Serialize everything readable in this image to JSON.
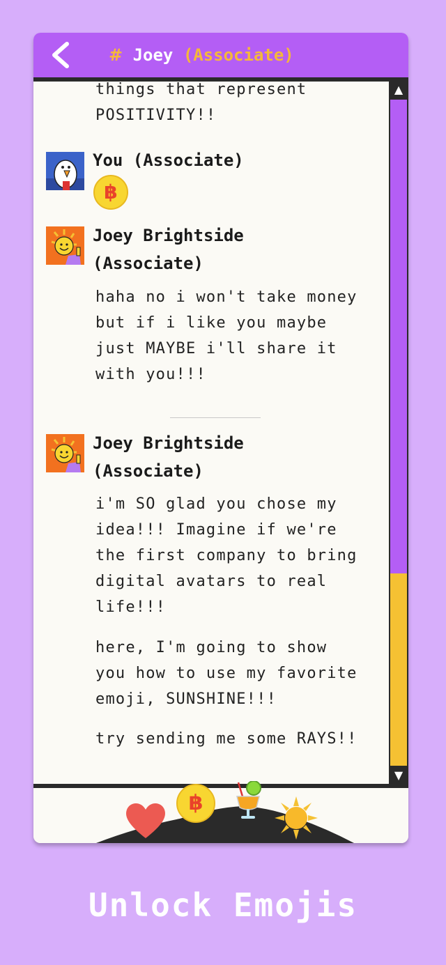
{
  "header": {
    "back_icon": "chevron-left-icon",
    "channel_hash": "#",
    "channel_name": "Joey",
    "channel_role": "(Associate)"
  },
  "messages": [
    {
      "lines": [
        "things that represent",
        "POSITIVITY!!"
      ]
    },
    {
      "author": "You (Associate)",
      "avatar": "bird-avatar",
      "emoji": "bitcoin-coin",
      "coin_symbol": "฿"
    },
    {
      "author_line1": "Joey Brightside",
      "author_line2": "(Associate)",
      "avatar": "sunshine-avatar",
      "lines": [
        "haha no i won't take money",
        "but if i like you maybe",
        "just MAYBE i'll share it",
        "with you!!!"
      ]
    },
    {
      "author_line1": "Joey Brightside",
      "author_line2": "(Associate)",
      "avatar": "sunshine-avatar",
      "paragraph1": [
        "i'm SO glad you chose my",
        "idea!!! Imagine if we're",
        "the first company to bring",
        "digital avatars to real",
        "life!!!"
      ],
      "paragraph2": [
        "here, I'm going to show",
        "you how to use my favorite",
        "emoji, SUNSHINE!!!"
      ],
      "paragraph3": [
        "try sending me some RAYS!!"
      ]
    }
  ],
  "scrollbar": {
    "up_glyph": "▲",
    "down_glyph": "▼",
    "position_fraction": 0.71
  },
  "emoji_tray": {
    "items": [
      "heart-emoji",
      "bitcoin-coin-emoji",
      "cocktail-emoji",
      "sun-emoji"
    ],
    "coin_symbol": "฿"
  },
  "footer": {
    "title": "Unlock Emojis"
  },
  "colors": {
    "background": "#d7aefb",
    "accent_purple": "#b45ef5",
    "accent_yellow": "#f5b83a",
    "scroll_thumb": "#f5c133"
  }
}
